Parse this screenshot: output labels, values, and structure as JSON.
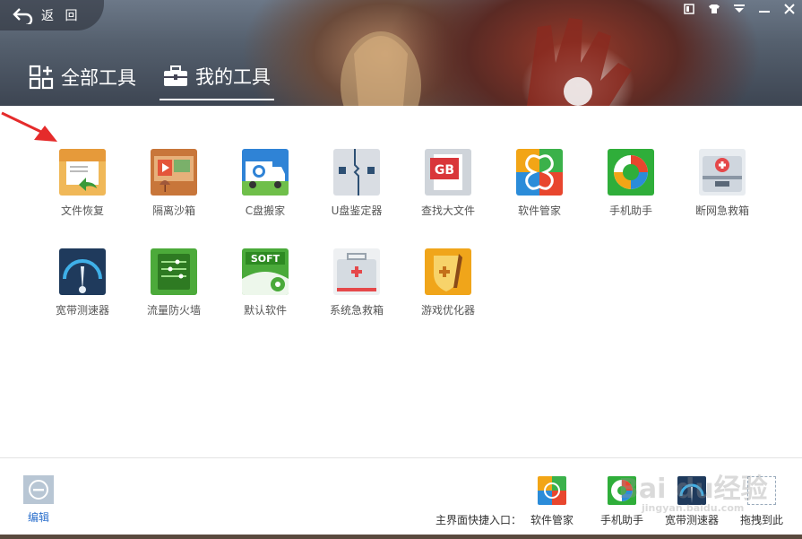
{
  "header": {
    "back_label": "返 回",
    "tabs": [
      {
        "label": "全部工具",
        "icon": "grid-plus-icon",
        "active": false
      },
      {
        "label": "我的工具",
        "icon": "toolbox-icon",
        "active": true
      }
    ],
    "window_controls": [
      "skin-icon",
      "shirt-icon",
      "menu-icon",
      "minimize-icon",
      "close-icon"
    ]
  },
  "tools": [
    {
      "label": "文件恢复",
      "icon": "file-restore-icon"
    },
    {
      "label": "隔离沙箱",
      "icon": "sandbox-icon"
    },
    {
      "label": "C盘搬家",
      "icon": "c-drive-move-icon"
    },
    {
      "label": "U盘鉴定器",
      "icon": "usb-checker-icon"
    },
    {
      "label": "查找大文件",
      "icon": "big-file-finder-icon"
    },
    {
      "label": "软件管家",
      "icon": "software-manager-icon"
    },
    {
      "label": "手机助手",
      "icon": "phone-assistant-icon"
    },
    {
      "label": "断网急救箱",
      "icon": "network-rescue-icon"
    },
    {
      "label": "宽带测速器",
      "icon": "speed-test-icon"
    },
    {
      "label": "流量防火墙",
      "icon": "traffic-firewall-icon"
    },
    {
      "label": "默认软件",
      "icon": "default-software-icon"
    },
    {
      "label": "系统急救箱",
      "icon": "system-rescue-icon"
    },
    {
      "label": "游戏优化器",
      "icon": "game-optimizer-icon"
    }
  ],
  "footer": {
    "edit_label": "编辑",
    "quick_entry_label": "主界面快捷入口：",
    "shortcuts": [
      {
        "label": "软件管家",
        "icon": "software-manager-icon"
      },
      {
        "label": "手机助手",
        "icon": "phone-assistant-icon"
      },
      {
        "label": "宽带测速器",
        "icon": "speed-test-icon"
      },
      {
        "label": "拖拽到此",
        "icon": "drop-zone-icon"
      }
    ]
  },
  "watermark": {
    "text": "Bai du经验",
    "sub": "jingyan.baidu.com"
  }
}
